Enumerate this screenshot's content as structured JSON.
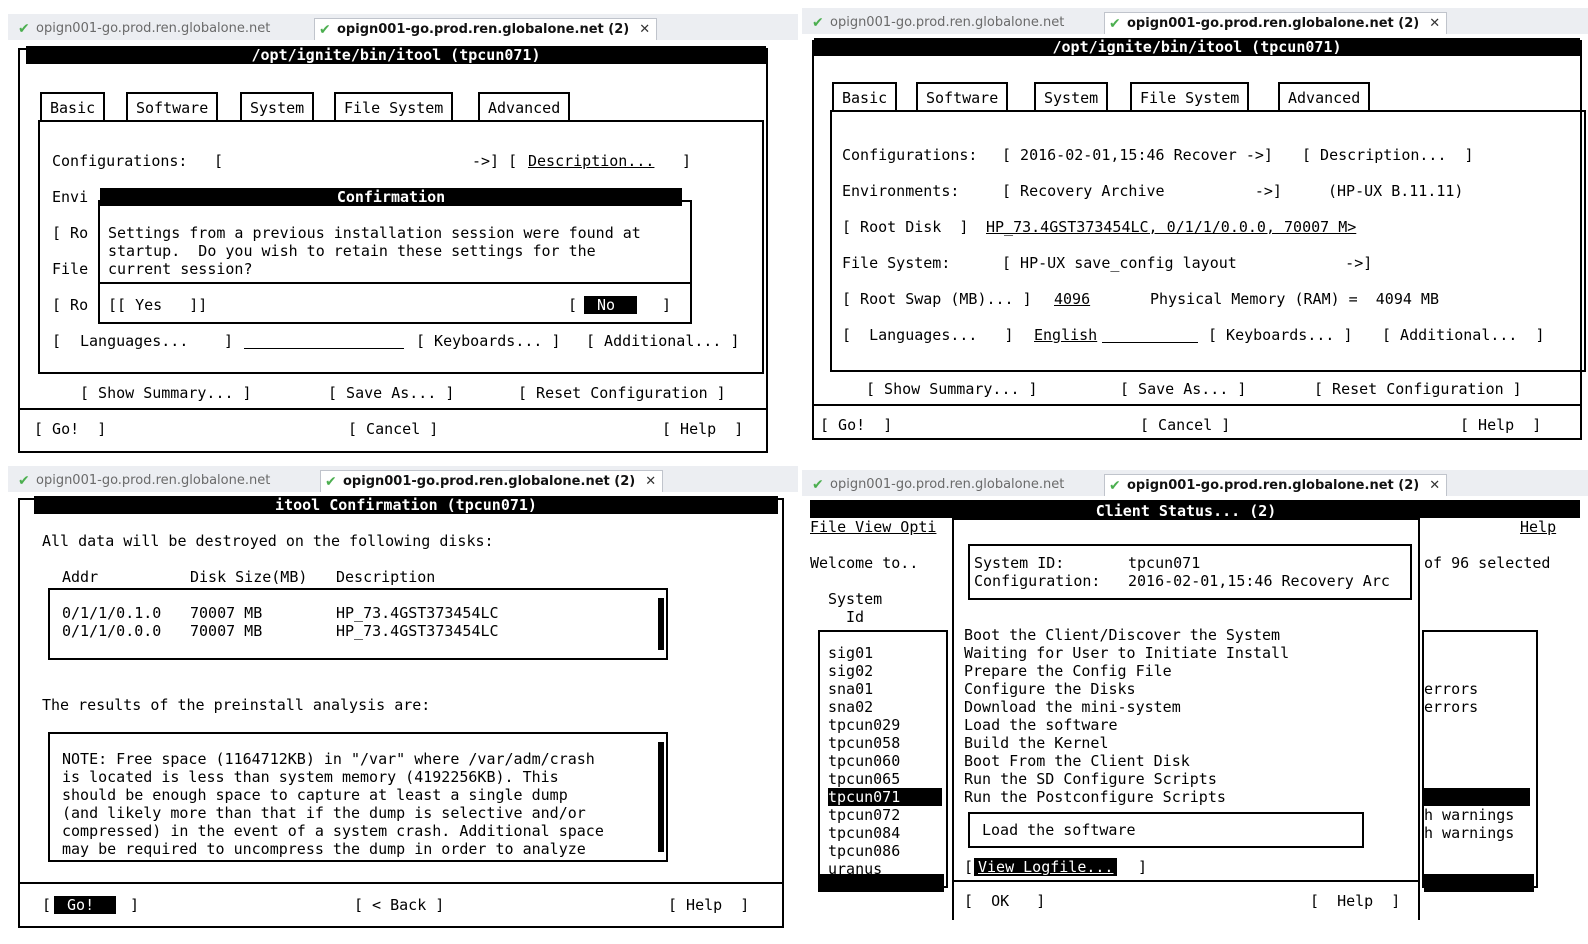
{
  "browser_tabs": {
    "inactive": "opign001-go.prod.ren.globalone.net",
    "active": "opign001-go.prod.ren.globalone.net (2)",
    "close": "✕"
  },
  "tabs": [
    "Basic",
    "Software",
    "System",
    "File System",
    "Advanced"
  ],
  "tl": {
    "title": "/opt/ignite/bin/itool (tpcun071)",
    "config_label": "Configurations:",
    "config_open": "[",
    "config_arrow": "->] [",
    "description": "Description...",
    "description_close": "]",
    "env_partial": "Envi",
    "root_partial": "[ Ro",
    "file_partial": "File",
    "root2_partial": "[ Ro",
    "languages_open": "[",
    "languages": "Languages...",
    "languages_close": "]",
    "keyboards": "[ Keyboards... ]",
    "additional": "[ Additional... ]",
    "dialog_title": "Confirmation",
    "dialog_text": [
      "Settings from a previous installation session were found at",
      "startup.  Do you wish to retain these settings for the",
      "current session?"
    ],
    "yes": "[[ Yes   ]]",
    "no_open": "[",
    "no": " No  ",
    "no_close": "]",
    "show_summary": "[ Show Summary... ]",
    "save_as": "[ Save As... ]",
    "reset": "[ Reset Configuration ]",
    "go": "[ Go!  ]",
    "cancel": "[ Cancel ]",
    "help": "[ Help  ]"
  },
  "tr": {
    "title": "/opt/ignite/bin/itool (tpcun071)",
    "config_label": "Configurations:",
    "config_value": "[ 2016-02-01,15:46 Recover ->]",
    "description": "[ Description...  ]",
    "env_label": "Environments:",
    "env_value": "[ Recovery Archive          ->]",
    "env_hp": "(HP-UX B.11.11)",
    "root_disk": "[ Root Disk  ]",
    "root_disk_value": "HP_73.4GST373454LC, 0/1/1/0.0.0, 70007 M>",
    "fs_label": "File System:",
    "fs_value": "[ HP-UX save_config layout            ->]",
    "root_swap": "[ Root Swap (MB)... ]",
    "swap_value": "4096",
    "phys_mem": "Physical Memory (RAM) =  4094 MB",
    "languages": "[  Languages...   ]",
    "language_value": "English",
    "keyboards": "[ Keyboards... ]",
    "additional": "[ Additional...  ]",
    "show_summary": "[ Show Summary... ]",
    "save_as": "[ Save As... ]",
    "reset": "[ Reset Configuration ]",
    "go": "[ Go!  ]",
    "cancel": "[ Cancel ]",
    "help": "[ Help  ]"
  },
  "bl": {
    "title": "itool Confirmation (tpcun071)",
    "destroy_text": "All data will be destroyed on the following disks:",
    "col_addr": "Addr",
    "col_size": "Disk Size(MB)",
    "col_desc": "Description",
    "disks": [
      {
        "addr": "0/1/1/0.1.0",
        "size": "70007 MB",
        "desc": "HP_73.4GST373454LC"
      },
      {
        "addr": "0/1/1/0.0.0",
        "size": "70007 MB",
        "desc": "HP_73.4GST373454LC"
      }
    ],
    "results_text": "The results of the preinstall analysis are:",
    "note_lines": [
      "NOTE: Free space (1164712KB) in \"/var\" where /var/adm/crash",
      "is located is less than system memory (4192256KB). This",
      "should be enough space to capture at least a single dump",
      "(and likely more than that if the dump is selective and/or",
      "compressed) in the event of a system crash. Additional space",
      "may be required to uncompress the dump in order to analyze"
    ],
    "go": " Go!  ",
    "back": "[ < Back ]",
    "help": "[ Help  ]"
  },
  "br": {
    "menu_left": "File View Opti",
    "menu_help": "Help",
    "welcome": "Welcome to..",
    "selected": "of 96 selected",
    "sys_hdr1": "System",
    "sys_hdr2": "Id",
    "systems": [
      "sig01",
      "sig02",
      "sna01",
      "sna02",
      "tpcun029",
      "tpcun058",
      "tpcun060",
      "tpcun065",
      "tpcun071",
      "tpcun072",
      "tpcun084",
      "tpcun086",
      "uranus"
    ],
    "right_notes": [
      "errors",
      "errors",
      "",
      "",
      "",
      "",
      "h warnings",
      "h warnings"
    ],
    "dialog_title": "Client Status... (2)",
    "sysid_label": "System ID:",
    "sysid_value": "tpcun071",
    "config_label": "Configuration:",
    "config_value": "2016-02-01,15:46 Recovery Arc",
    "steps": [
      "Boot the Client/Discover the System",
      "Waiting for User to Initiate Install",
      "Prepare the Config File",
      "Configure the Disks",
      "Download the mini-system",
      "Load the software",
      "Build the Kernel",
      "Boot From the Client Disk",
      "Run the SD Configure Scripts",
      "Run the Postconfigure Scripts"
    ],
    "current_step": "Load the software",
    "view_logfile": "View Logfile...",
    "ok": "[  OK   ]",
    "help": "[  Help  ]"
  }
}
